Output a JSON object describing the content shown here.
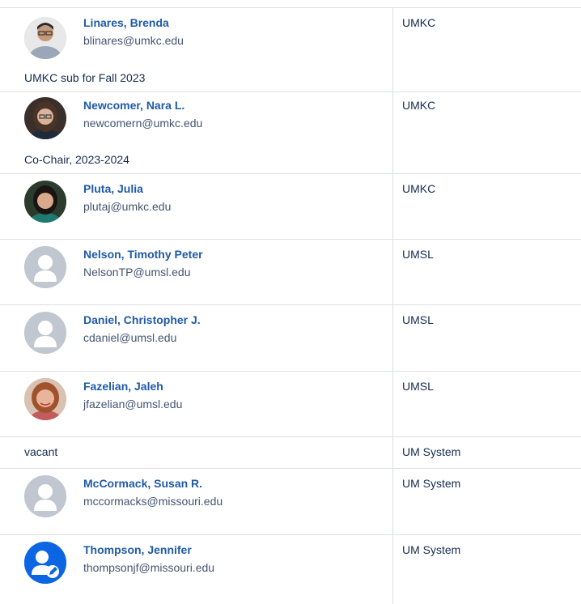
{
  "rows": [
    {
      "name": "Linares, Brenda",
      "email": "blinares@umkc.edu",
      "note": "UMKC sub for Fall 2023",
      "campus": "UMKC",
      "avatar": "photo"
    },
    {
      "name": "Newcomer, Nara L.",
      "email": "newcomern@umkc.edu",
      "note": "Co-Chair, 2023-2024",
      "campus": "UMKC",
      "avatar": "photo"
    },
    {
      "name": "Pluta, Julia",
      "email": "plutaj@umkc.edu",
      "note": "",
      "campus": "UMKC",
      "avatar": "photo"
    },
    {
      "name": "Nelson, Timothy Peter",
      "email": "NelsonTP@umsl.edu",
      "note": "",
      "campus": "UMSL",
      "avatar": "default-user-icon"
    },
    {
      "name": "Daniel, Christopher J.",
      "email": "cdaniel@umsl.edu",
      "note": "",
      "campus": "UMSL",
      "avatar": "default-user-icon"
    },
    {
      "name": "Fazelian, Jaleh",
      "email": "jfazelian@umsl.edu",
      "note": "",
      "campus": "UMSL",
      "avatar": "photo"
    },
    {
      "vacant": "vacant",
      "campus": "UM System"
    },
    {
      "name": "McCormack, Susan R.",
      "email": "mccormacks@missouri.edu",
      "note": "",
      "campus": "UM System",
      "avatar": "default-user-icon"
    },
    {
      "name": "Thompson, Jennifer",
      "email": "thompsonjf@missouri.edu",
      "note": "",
      "campus": "UM System",
      "avatar": "blue-user-edit-icon"
    }
  ],
  "colors": {
    "link": "#1f5aa6",
    "border": "#dcdfe4",
    "default_avatar_bg": "#c1c7d0",
    "edit_avatar_bg": "#0c66e4"
  }
}
